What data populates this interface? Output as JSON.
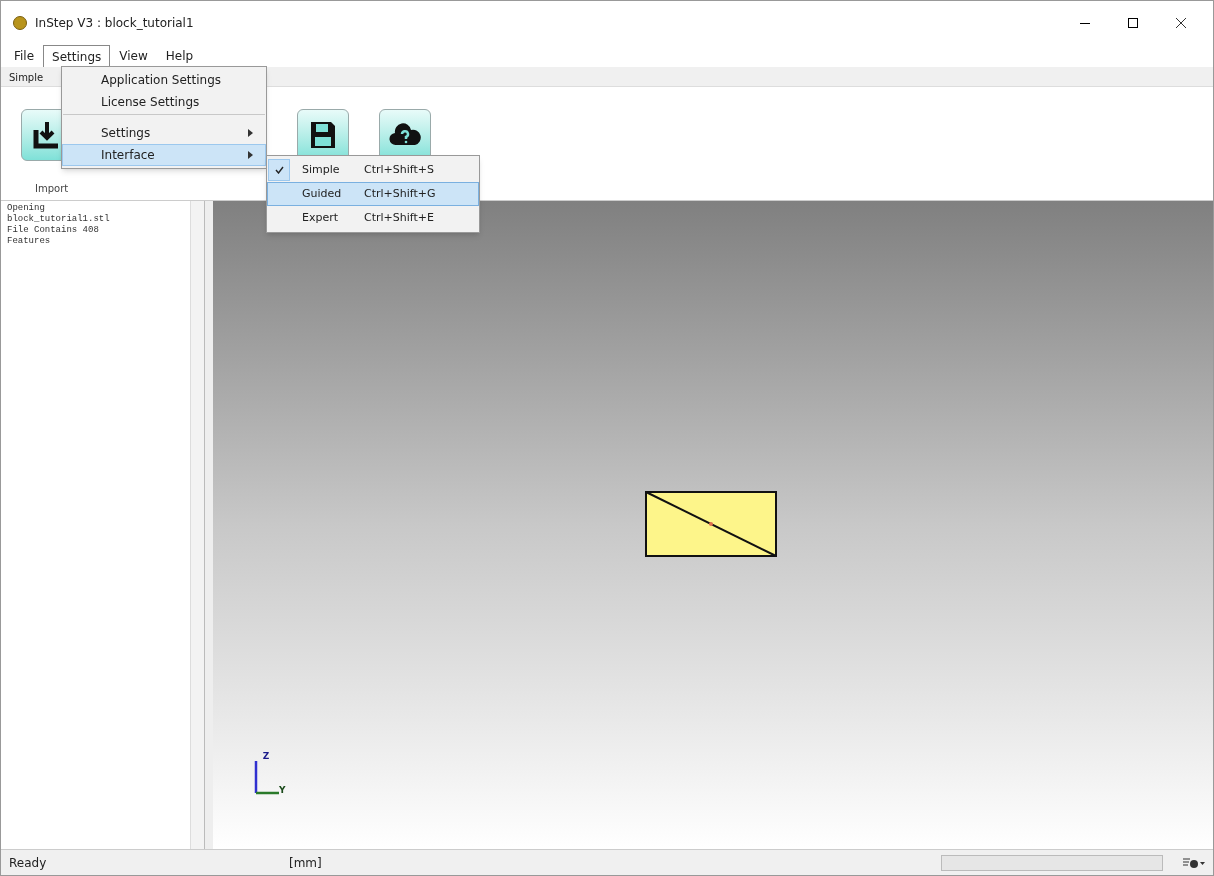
{
  "window": {
    "title": "InStep V3 : block_tutorial1"
  },
  "menu_bar": [
    {
      "label": "File",
      "selected": false
    },
    {
      "label": "Settings",
      "selected": true
    },
    {
      "label": "View",
      "selected": false
    },
    {
      "label": "Help",
      "selected": false
    }
  ],
  "ribbon_tab": {
    "label": "Simple"
  },
  "ribbon_label": "Import",
  "settings_menu": [
    {
      "label": "Application Settings",
      "has_submenu": false,
      "selected": false,
      "separator_before": false
    },
    {
      "label": "License Settings",
      "has_submenu": false,
      "selected": false,
      "separator_before": false
    },
    {
      "label": "Settings",
      "has_submenu": true,
      "selected": false,
      "separator_before": true
    },
    {
      "label": "Interface",
      "has_submenu": true,
      "selected": true,
      "separator_before": false
    }
  ],
  "interface_menu": [
    {
      "label": "Simple",
      "shortcut": "Ctrl+Shift+S",
      "checked": true,
      "selected": false
    },
    {
      "label": "Guided",
      "shortcut": "Ctrl+Shift+G",
      "checked": false,
      "selected": true
    },
    {
      "label": "Expert",
      "shortcut": "Ctrl+Shift+E",
      "checked": false,
      "selected": false
    }
  ],
  "log": [
    "Opening",
    "block_tutorial1.stl",
    "File Contains 408",
    "Features"
  ],
  "axes": {
    "vertical": "Z",
    "horizontal": "Y"
  },
  "status_bar": {
    "status": "Ready",
    "units": "[mm]",
    "progress": {
      "level": 0
    }
  }
}
